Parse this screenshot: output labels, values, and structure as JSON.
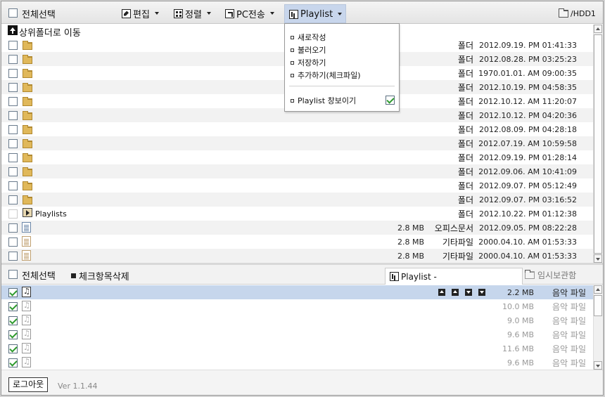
{
  "toolbar": {
    "select_all": "전체선택",
    "edit": "편집",
    "sort": "정렬",
    "pc_transfer": "PC전송",
    "playlist": "Playlist",
    "path": "/HDD1"
  },
  "upfolder": {
    "label": "상위폴더로 이동"
  },
  "files": [
    {
      "kind": "folder",
      "name": "",
      "size": "",
      "type": "폴더",
      "date": "2012.09.19. PM 01:41:33"
    },
    {
      "kind": "folder",
      "name": "",
      "size": "",
      "type": "폴더",
      "date": "2012.08.28. PM 03:25:23"
    },
    {
      "kind": "folder",
      "name": "",
      "size": "",
      "type": "폴더",
      "date": "1970.01.01. AM 09:00:35"
    },
    {
      "kind": "folder",
      "name": "",
      "size": "",
      "type": "폴더",
      "date": "2012.10.19. PM 04:58:35"
    },
    {
      "kind": "folder",
      "name": "",
      "size": "",
      "type": "폴더",
      "date": "2012.10.12. AM 11:20:07"
    },
    {
      "kind": "folder",
      "name": "",
      "size": "",
      "type": "폴더",
      "date": "2012.10.12. PM 04:20:36"
    },
    {
      "kind": "folder",
      "name": "",
      "size": "",
      "type": "폴더",
      "date": "2012.08.09. PM 04:28:18"
    },
    {
      "kind": "folder",
      "name": "",
      "size": "",
      "type": "폴더",
      "date": "2012.07.19. AM 10:59:58"
    },
    {
      "kind": "folder",
      "name": "",
      "size": "",
      "type": "폴더",
      "date": "2012.09.19. PM 01:28:14"
    },
    {
      "kind": "folder",
      "name": "",
      "size": "",
      "type": "폴더",
      "date": "2012.09.06. AM 10:41:09"
    },
    {
      "kind": "folder",
      "name": "",
      "size": "",
      "type": "폴더",
      "date": "2012.09.07. PM 05:12:49"
    },
    {
      "kind": "folder",
      "name": "",
      "size": "",
      "type": "폴더",
      "date": "2012.09.07. PM 03:16:52"
    },
    {
      "kind": "playlist",
      "name": "Playlists",
      "size": "",
      "type": "폴더",
      "date": "2012.10.22. PM 01:12:38"
    },
    {
      "kind": "doc",
      "name": "",
      "size": "2.8 MB",
      "type": "오피스문서",
      "date": "2012.09.05. PM 08:22:28"
    },
    {
      "kind": "other",
      "name": "",
      "size": "2.8 MB",
      "type": "기타파일",
      "date": "2000.04.10. AM 01:53:33"
    },
    {
      "kind": "other",
      "name": "",
      "size": "2.8 MB",
      "type": "기타파일",
      "date": "2000.04.10. AM 01:53:33"
    }
  ],
  "dropdown": {
    "items": [
      "새로작성",
      "불러오기",
      "저장하기",
      "추가하기(체크파일)"
    ],
    "toggle_label": "Playlist 창보이기",
    "toggle_checked": true
  },
  "lower": {
    "select_all": "전체선택",
    "delete_checked": "체크항목삭제",
    "playlist_tab": "Playlist  -",
    "temp_tab": "임시보관함"
  },
  "playlist_items": [
    {
      "size": "2.2 MB",
      "type": "음악 파일",
      "selected": true
    },
    {
      "size": "10.0 MB",
      "type": "음악 파일",
      "selected": false
    },
    {
      "size": "9.0 MB",
      "type": "음악 파일",
      "selected": false
    },
    {
      "size": "9.6 MB",
      "type": "음악 파일",
      "selected": false
    },
    {
      "size": "11.6 MB",
      "type": "음악 파일",
      "selected": false
    },
    {
      "size": "9.6 MB",
      "type": "음악 파일",
      "selected": false
    }
  ],
  "footer": {
    "logout": "로그아웃",
    "version": "Ver 1.1.44"
  },
  "colors": {
    "selection": "#c6d6ec",
    "folder": "#e0b85a",
    "check": "#2e9a2e"
  }
}
